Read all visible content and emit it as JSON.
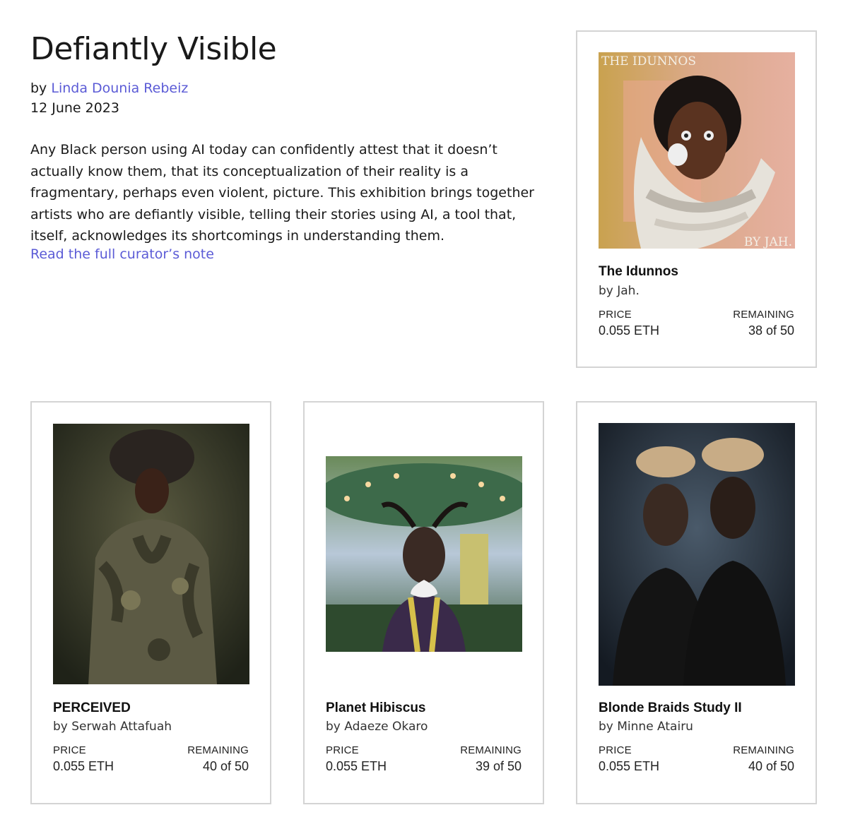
{
  "exhibition": {
    "title": "Defiantly Visible",
    "by_prefix": "by",
    "curator": "Linda Dounia Rebeiz",
    "date": "12 June 2023",
    "description": "Any Black person using AI today can confidently attest that it doesn’t actually know them, that its conceptualization of their reality is a fragmentary, perhaps even violent, picture. This exhibition brings together artists who are defiantly visible, telling their stories using AI, a tool that, itself, acknowledges its shortcomings in understanding them.",
    "read_more": "Read the full curator’s note"
  },
  "labels": {
    "price": "PRICE",
    "remaining": "REMAINING"
  },
  "artworks": [
    {
      "title": "The Idunnos",
      "artist": "by Jah.",
      "price": "0.055 ETH",
      "remaining": "38 of 50",
      "art_text_top": "THE IDUNNOS",
      "art_text_bottom": "BY JAH."
    },
    {
      "title": "PERCEIVED",
      "artist": "by Serwah Attafuah",
      "price": "0.055 ETH",
      "remaining": "40 of 50"
    },
    {
      "title": "Planet Hibiscus",
      "artist": "by Adaeze Okaro",
      "price": "0.055 ETH",
      "remaining": "39 of 50"
    },
    {
      "title": "Blonde Braids Study II",
      "artist": "by Minne Atairu",
      "price": "0.055 ETH",
      "remaining": "40 of 50"
    }
  ],
  "colors": {
    "link": "#5b5bd6",
    "border": "#d4d4d4",
    "text": "#1a1a1a"
  }
}
